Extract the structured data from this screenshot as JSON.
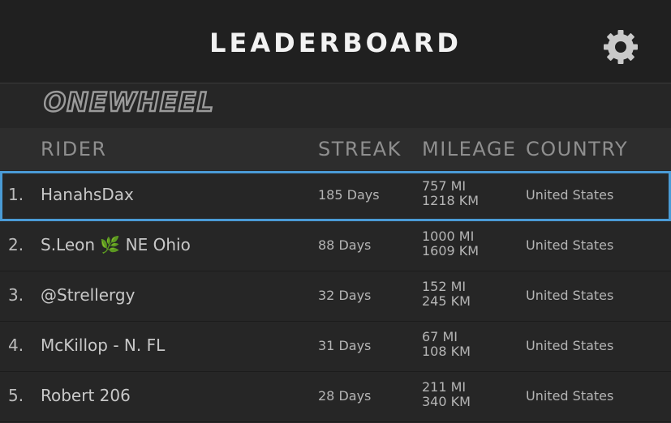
{
  "header": {
    "title": "LEADERBOARD",
    "settings_icon": "gear-icon"
  },
  "brand": {
    "logo_text": "ONEWHEEL"
  },
  "table": {
    "columns": {
      "rider": "RIDER",
      "streak": "STREAK",
      "mileage": "MILEAGE",
      "country": "COUNTRY"
    },
    "rows": [
      {
        "rank": "1.",
        "name": "HanahsDax",
        "streak": "185 Days",
        "miles": "757 MI",
        "km": "1218 KM",
        "country": "United States"
      },
      {
        "rank": "2.",
        "name": "S.Leon 🌿 NE Ohio",
        "streak": "88 Days",
        "miles": "1000 MI",
        "km": "1609 KM",
        "country": "United States"
      },
      {
        "rank": "3.",
        "name": "@Strellergy",
        "streak": "32 Days",
        "miles": "152 MI",
        "km": "245 KM",
        "country": "United States"
      },
      {
        "rank": "4.",
        "name": "McKillop - N. FL",
        "streak": "31 Days",
        "miles": "67 MI",
        "km": "108 KM",
        "country": "United States"
      },
      {
        "rank": "5.",
        "name": "Robert 206",
        "streak": "28 Days",
        "miles": "211 MI",
        "km": "340 KM",
        "country": "United States"
      }
    ]
  },
  "colors": {
    "background": "#262626",
    "header_background": "#2d2d2d",
    "selected_border": "#4a9bd6"
  }
}
